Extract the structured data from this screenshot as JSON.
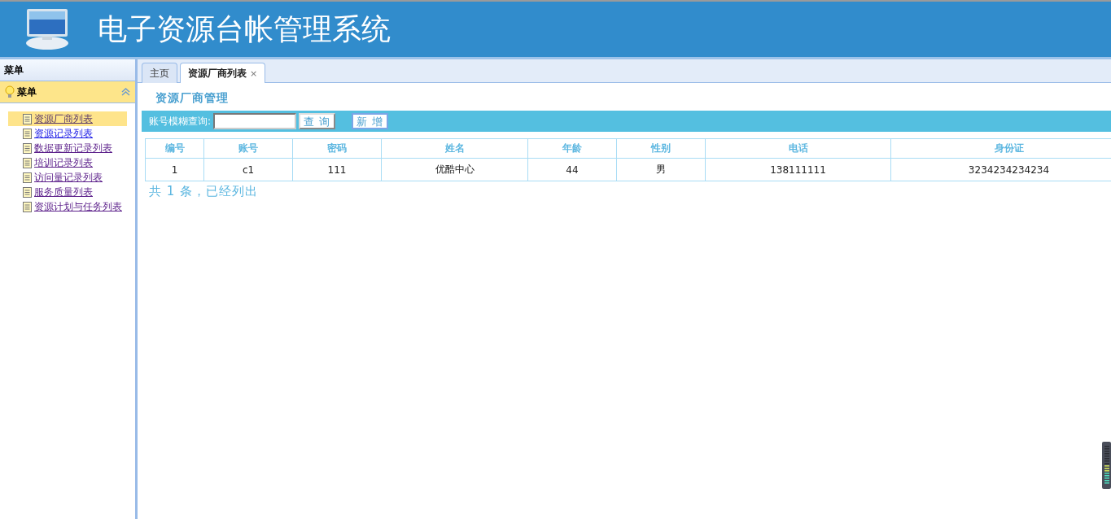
{
  "header": {
    "title": "电子资源台帐管理系统"
  },
  "sidebar": {
    "title": "菜单",
    "panel": {
      "title": "菜单",
      "expanded": true
    },
    "items": [
      {
        "label": "资源厂商列表",
        "selected": true,
        "visited": true
      },
      {
        "label": "资源记录列表",
        "selected": false,
        "visited": false
      },
      {
        "label": "数据更新记录列表",
        "selected": false,
        "visited": true
      },
      {
        "label": "培训记录列表",
        "selected": false,
        "visited": true
      },
      {
        "label": "访问量记录列表",
        "selected": false,
        "visited": true
      },
      {
        "label": "服务质量列表",
        "selected": false,
        "visited": true
      },
      {
        "label": "资源计划与任务列表",
        "selected": false,
        "visited": true
      }
    ]
  },
  "tabs": [
    {
      "label": "主页",
      "selected": false,
      "closable": false
    },
    {
      "label": "资源厂商列表",
      "selected": true,
      "closable": true,
      "close": "×"
    }
  ],
  "page": {
    "title": "资源厂商管理",
    "search": {
      "label": "账号模糊查询:",
      "query_button": "查 询",
      "add_button": "新 增"
    },
    "table": {
      "columns": [
        "编号",
        "账号",
        "密码",
        "姓名",
        "年龄",
        "性别",
        "电话",
        "身份证"
      ],
      "rows": [
        [
          "1",
          "c1",
          "111",
          "优酷中心",
          "44",
          "男",
          "138111111",
          "3234234234234"
        ]
      ]
    },
    "summary": "共 1 条，已经列出"
  }
}
